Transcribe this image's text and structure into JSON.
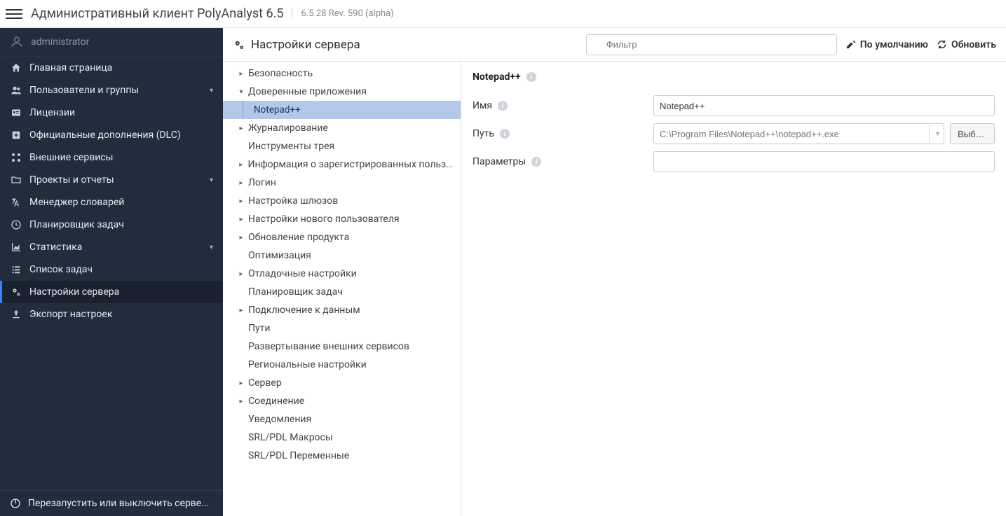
{
  "header": {
    "title": "Административный клиент PolyAnalyst 6.5",
    "version": "6.5.28 Rev. 590 (alpha)"
  },
  "user": {
    "name": "administrator"
  },
  "sidebar": {
    "items": [
      {
        "label": "Главная страница",
        "expandable": false
      },
      {
        "label": "Пользователи и группы",
        "expandable": true
      },
      {
        "label": "Лицензии",
        "expandable": false
      },
      {
        "label": "Официальные дополнения (DLC)",
        "expandable": false
      },
      {
        "label": "Внешние сервисы",
        "expandable": false
      },
      {
        "label": "Проекты и отчеты",
        "expandable": true
      },
      {
        "label": "Менеджер словарей",
        "expandable": false
      },
      {
        "label": "Планировщик задач",
        "expandable": false
      },
      {
        "label": "Статистика",
        "expandable": true
      },
      {
        "label": "Список задач",
        "expandable": false
      },
      {
        "label": "Настройки сервера",
        "expandable": false
      },
      {
        "label": "Экспорт настроек",
        "expandable": false
      }
    ],
    "footer": "Перезапустить или выключить серве..."
  },
  "contentHeader": {
    "title": "Настройки сервера",
    "filter_placeholder": "Фильтр",
    "defaults_btn": "По умолчанию",
    "refresh_btn": "Обновить"
  },
  "tree": [
    {
      "label": "Безопасность",
      "type": "branch"
    },
    {
      "label": "Доверенные приложения",
      "type": "branch-open"
    },
    {
      "label": "Notepad++",
      "type": "child",
      "selected": true
    },
    {
      "label": "Журналирование",
      "type": "branch"
    },
    {
      "label": "Инструменты трея",
      "type": "leaf"
    },
    {
      "label": "Информация о зарегистрированных пользов...",
      "type": "branch"
    },
    {
      "label": "Логин",
      "type": "branch"
    },
    {
      "label": "Настройка шлюзов",
      "type": "branch"
    },
    {
      "label": "Настройки нового пользователя",
      "type": "branch"
    },
    {
      "label": "Обновление продукта",
      "type": "branch"
    },
    {
      "label": "Оптимизация",
      "type": "leaf"
    },
    {
      "label": "Отладочные настройки",
      "type": "branch"
    },
    {
      "label": "Планировщик задач",
      "type": "leaf"
    },
    {
      "label": "Подключение к данным",
      "type": "branch"
    },
    {
      "label": "Пути",
      "type": "leaf"
    },
    {
      "label": "Развертывание внешних сервисов",
      "type": "leaf"
    },
    {
      "label": "Региональные настройки",
      "type": "leaf"
    },
    {
      "label": "Сервер",
      "type": "branch"
    },
    {
      "label": "Соединение",
      "type": "branch"
    },
    {
      "label": "Уведомления",
      "type": "leaf"
    },
    {
      "label": "SRL/PDL Макросы",
      "type": "leaf"
    },
    {
      "label": "SRL/PDL Переменные",
      "type": "leaf"
    }
  ],
  "detail": {
    "title": "Notepad++",
    "name_label": "Имя",
    "name_value": "Notepad++",
    "path_label": "Путь",
    "path_placeholder": "C:\\Program Files\\Notepad++\\notepad++.exe",
    "browse_label": "Выбор...",
    "params_label": "Параметры",
    "params_value": ""
  }
}
